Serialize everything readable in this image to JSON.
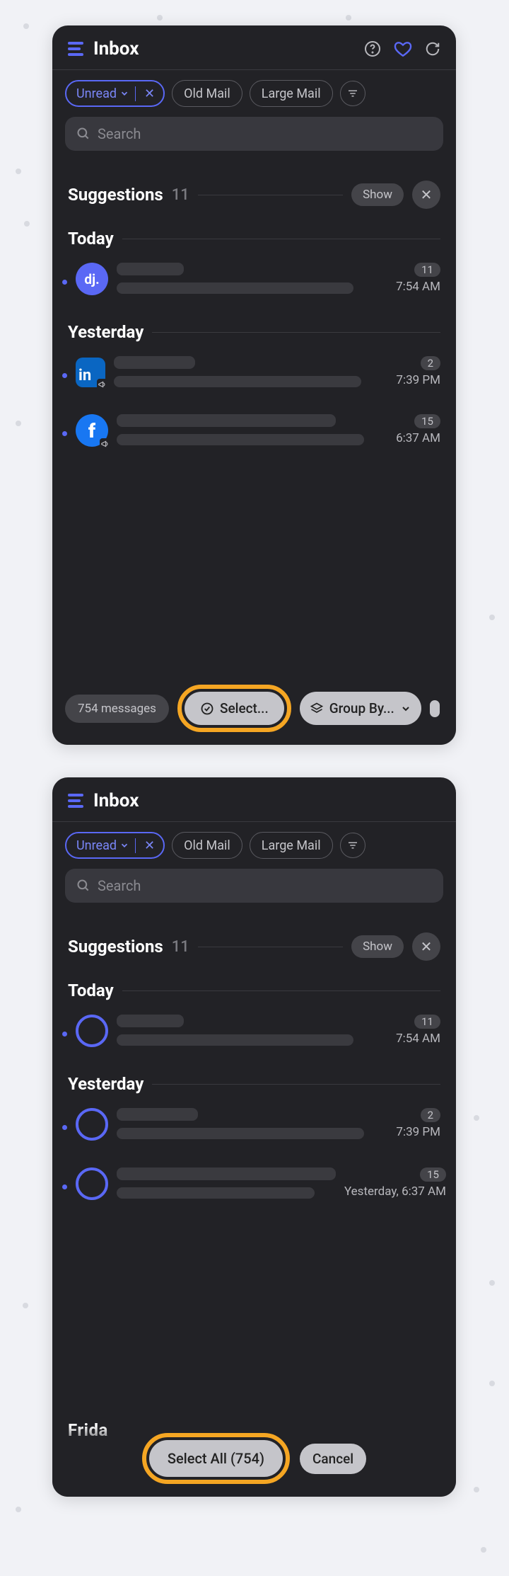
{
  "panel": {
    "title": "Inbox",
    "filters": {
      "unread": "Unread",
      "old": "Old Mail",
      "large": "Large Mail"
    },
    "searchPlaceholder": "Search",
    "suggestions": {
      "title": "Suggestions",
      "count": "11",
      "show": "Show"
    }
  },
  "sections": {
    "today": "Today",
    "yesterday": "Yesterday",
    "friday_abbrev": "Frida"
  },
  "messages": {
    "dj": {
      "avatar_text": "dj.",
      "badge": "11",
      "time": "7:54 AM"
    },
    "li": {
      "avatar_text": "in",
      "badge": "2",
      "time": "7:39 PM"
    },
    "fb": {
      "avatar_text": "f",
      "badge": "15",
      "time1": "6:37 AM",
      "time2": "Yesterday, 6:37 AM"
    }
  },
  "bottom1": {
    "count": "754 messages",
    "select": "Select...",
    "group": "Group By..."
  },
  "bottom2": {
    "selectAll": "Select All (754)",
    "cancel": "Cancel"
  }
}
